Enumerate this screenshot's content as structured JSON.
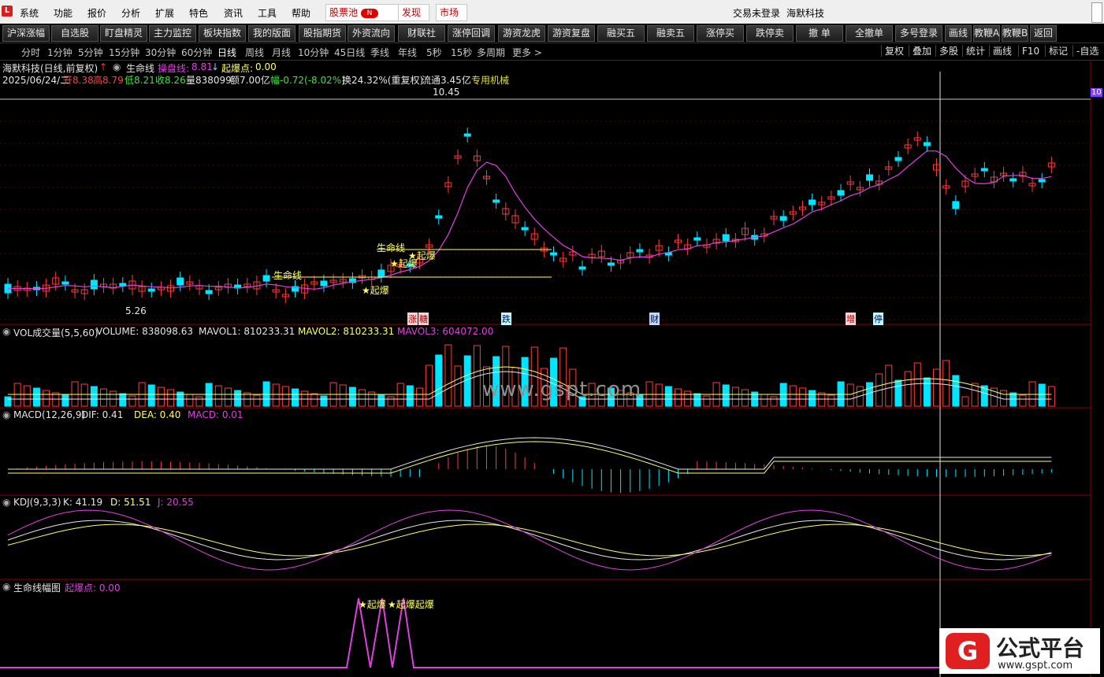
{
  "menubar": {
    "logo_glyph": "L",
    "items": [
      "系统",
      "功能",
      "报价",
      "分析",
      "扩展",
      "特色",
      "资讯",
      "工具",
      "帮助"
    ],
    "stock_pool": "股票池",
    "stock_pool_badge": "N",
    "discover": "发现",
    "market": "市场",
    "login_status": "交易未登录",
    "stock_name": "海默科技"
  },
  "toolbar": {
    "buttons": [
      "沪深涨幅",
      "自选股",
      "盯盘精灵",
      "主力监控",
      "板块指数",
      "我的版面",
      "股指期货",
      "外资流向",
      "财联社",
      "涨停回调",
      "游资龙虎",
      "游资复盘",
      "融买五",
      "融卖五",
      "涨停买",
      "跌停卖",
      "撤 单",
      "全撤单",
      "多号登录",
      "画线",
      "教鞭A",
      "教鞭B",
      "返回"
    ]
  },
  "periodbar": {
    "periods": [
      "分时",
      "1分钟",
      "5分钟",
      "15分钟",
      "30分钟",
      "60分钟",
      "日线",
      "周线",
      "月线",
      "10分钟",
      "45日线",
      "季线",
      "年线",
      "5秒",
      "15秒",
      "多周期",
      "更多 >"
    ],
    "active": "日线",
    "right_buttons": [
      "复权",
      "叠加",
      "多股",
      "统计",
      "画线",
      "F10",
      "标记",
      "-自选"
    ]
  },
  "main_panel": {
    "title": "海默科技(日线,前复权)",
    "indicator": "生命线",
    "line1_label": "操盘线:",
    "line1_value": "8.81",
    "line2_label": "起爆点:",
    "line2_value": "0.00",
    "date": "2025/06/24/二",
    "open": "开8.38",
    "high": "高8.79",
    "low": "低8.21",
    "close": "收8.26",
    "volume": "量838099",
    "amount": "额7.00亿",
    "change": "幅-0.72(-8.02%)",
    "turnover": "换24.32%(重复权)",
    "float": "流通3.45亿",
    "sector": "专用机械",
    "high_mark": "10.45",
    "low_mark": "5.26",
    "right_edge": "10",
    "annotations": {
      "lifeline": "生命线",
      "qibao": "★起爆",
      "qibao2": "★起爆",
      "tag1": "涨",
      "tag2": "糖",
      "tag3": "跌",
      "tag4": "财",
      "tag5": "增",
      "tag6": "停"
    }
  },
  "vol_panel": {
    "title": "VOL成交量(5,5,60)",
    "volume": "VOLUME: 838098.63",
    "mavol1": "MAVOL1: 810233.31",
    "mavol2": "MAVOL2: 810233.31",
    "mavol3": "MAVOL3: 604072.00"
  },
  "macd_panel": {
    "title": "MACD(12,26,9)",
    "dif": "DIF: 0.41",
    "dea": "DEA: 0.40",
    "macd": "MACD: 0.01"
  },
  "kdj_panel": {
    "title": "KDJ(9,3,3)",
    "k": "K: 41.19",
    "d": "D: 51.51",
    "j": "J: 20.55"
  },
  "lifeline_panel": {
    "title": "生命线幅图",
    "value": "起爆点: 0.00",
    "labels": [
      "★起爆",
      "★起爆起爆"
    ]
  },
  "watermark": {
    "site": "www.gspt.com",
    "brand": "公式平台",
    "brand_url": "www.gspt.com",
    "brand_glyph": "G"
  },
  "colors": {
    "up": "#ff3c3c",
    "down": "#00e5ff",
    "ma_magenta": "#e040e0",
    "yellow": "#ffff66",
    "white": "#e6e6e6",
    "grid": "#8b0000"
  }
}
